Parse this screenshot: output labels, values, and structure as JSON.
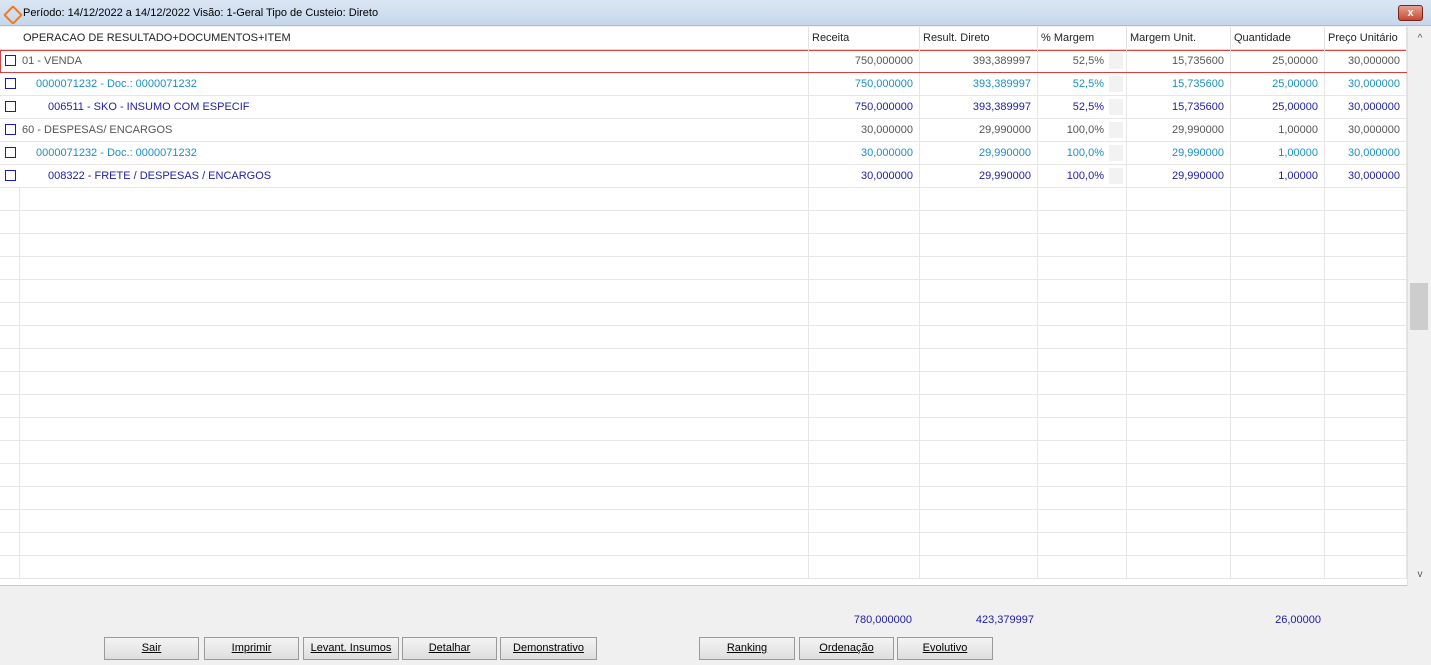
{
  "window": {
    "title": "Período: 14/12/2022 a 14/12/2022 Visão:  1-Geral Tipo de Custeio: Direto",
    "close_label": "x"
  },
  "columns": [
    "OPERACAO DE RESULTADO+DOCUMENTOS+ITEM",
    "Receita",
    "Result. Direto",
    "% Margem",
    "Margem Unit.",
    "Quantidade",
    "Preço Unitário"
  ],
  "rows": [
    {
      "label": "01 - VENDA",
      "receita": "750,000000",
      "result": "393,389997",
      "margem": "52,5%",
      "margem_unit": "15,735600",
      "qtd": "25,00000",
      "preco": "30,000000"
    },
    {
      "label": "0000071232 - Doc.: 0000071232",
      "receita": "750,000000",
      "result": "393,389997",
      "margem": "52,5%",
      "margem_unit": "15,735600",
      "qtd": "25,00000",
      "preco": "30,000000"
    },
    {
      "label": "006511 - SKO - INSUMO COM ESPECIF",
      "receita": "750,000000",
      "result": "393,389997",
      "margem": "52,5%",
      "margem_unit": "15,735600",
      "qtd": "25,00000",
      "preco": "30,000000"
    },
    {
      "label": "60 - DESPESAS/ ENCARGOS",
      "receita": "30,000000",
      "result": "29,990000",
      "margem": "100,0%",
      "margem_unit": "29,990000",
      "qtd": "1,00000",
      "preco": "30,000000"
    },
    {
      "label": "0000071232 - Doc.: 0000071232",
      "receita": "30,000000",
      "result": "29,990000",
      "margem": "100,0%",
      "margem_unit": "29,990000",
      "qtd": "1,00000",
      "preco": "30,000000"
    },
    {
      "label": "008322 - FRETE / DESPESAS / ENCARGOS",
      "receita": "30,000000",
      "result": "29,990000",
      "margem": "100,0%",
      "margem_unit": "29,990000",
      "qtd": "1,00000",
      "preco": "30,000000"
    }
  ],
  "totals": {
    "receita": "780,000000",
    "result": "423,379997",
    "qtd": "26,00000"
  },
  "buttons": {
    "sair": "Sair",
    "imprimir": "Imprimir",
    "levant": "Levant. Insumos",
    "detalhar": "Detalhar",
    "demonstrativo": "Demonstrativo",
    "ranking": "Ranking",
    "ordenacao": "Ordenação",
    "evolutivo": "Evolutivo"
  },
  "scroll": {
    "up": "^",
    "down": "v"
  }
}
